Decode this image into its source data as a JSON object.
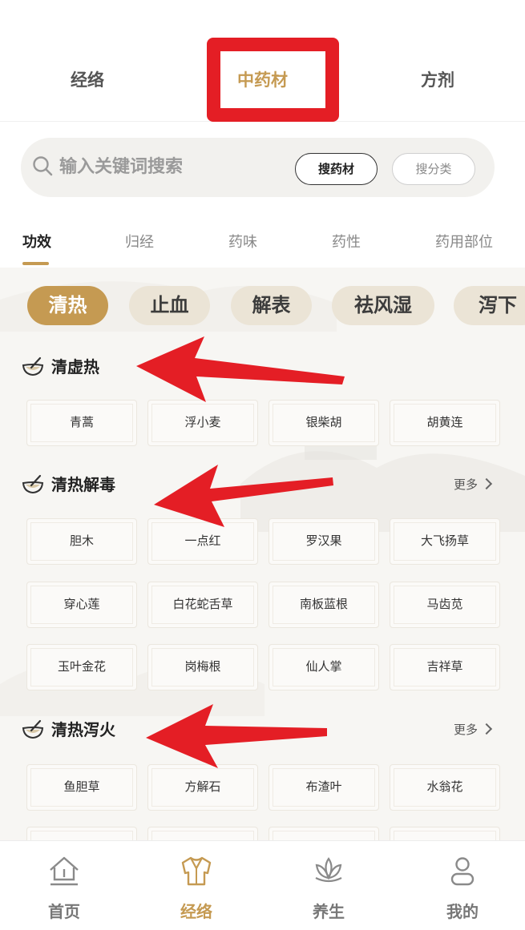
{
  "top_tabs": [
    "经络",
    "中药材",
    "方剂"
  ],
  "search": {
    "placeholder": "输入关键词搜索",
    "btn_herb": "搜药材",
    "btn_category": "搜分类"
  },
  "category_tabs": [
    "功效",
    "归经",
    "药味",
    "药性",
    "药用部位"
  ],
  "pills": [
    "清热",
    "止血",
    "解表",
    "祛风湿",
    "泻下"
  ],
  "sections": [
    {
      "title": "清虚热",
      "more": "",
      "items": [
        "青蒿",
        "浮小麦",
        "银柴胡",
        "胡黄连"
      ]
    },
    {
      "title": "清热解毒",
      "more": "更多",
      "items": [
        "胆木",
        "一点红",
        "罗汉果",
        "大飞扬草",
        "穿心莲",
        "白花蛇舌草",
        "南板蓝根",
        "马齿苋",
        "玉叶金花",
        "岗梅根",
        "仙人掌",
        "吉祥草"
      ]
    },
    {
      "title": "清热泻火",
      "more": "更多",
      "items": [
        "鱼胆草",
        "方解石",
        "布渣叶",
        "水翁花"
      ]
    }
  ],
  "bottom_nav": [
    "首页",
    "经络",
    "养生",
    "我的"
  ],
  "colors": {
    "accent": "#c59a52",
    "annotation_red": "#e41e25",
    "pill_bg": "#ebe4d6"
  }
}
